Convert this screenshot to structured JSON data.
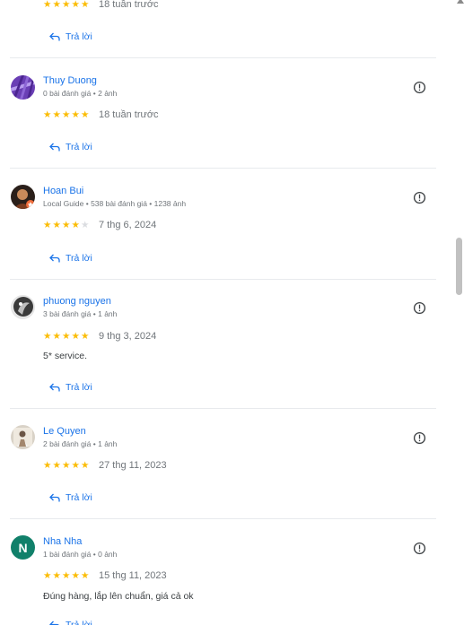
{
  "reply_label": "Trả lời",
  "colors": {
    "accent": "#1a73e8",
    "star": "#fbbc04",
    "avatar_n": "#11806a"
  },
  "top_partial": {
    "rating": 5,
    "date": "18 tuần trước"
  },
  "reviews": [
    {
      "name": "Thuy Duong",
      "meta": "0 bài đánh giá • 2 ảnh",
      "rating": 5,
      "date": "18 tuần trước",
      "text": ""
    },
    {
      "name": "Hoan Bui",
      "meta": "Local Guide • 538 bài đánh giá • 1238 ảnh",
      "rating": 4,
      "date": "7 thg 6, 2024",
      "text": ""
    },
    {
      "name": "phuong nguyen",
      "meta": "3 bài đánh giá • 1 ảnh",
      "rating": 5,
      "date": "9 thg 3, 2024",
      "text": "5* service."
    },
    {
      "name": "Le Quyen",
      "meta": "2 bài đánh giá • 1 ảnh",
      "rating": 5,
      "date": "27 thg 11, 2023",
      "text": ""
    },
    {
      "name": "Nha Nha",
      "avatar_letter": "N",
      "meta": "1 bài đánh giá • 0 ảnh",
      "rating": 5,
      "date": "15 thg 11, 2023",
      "text": "Đúng hàng, lắp lên chuẩn, giá cả ok"
    }
  ]
}
